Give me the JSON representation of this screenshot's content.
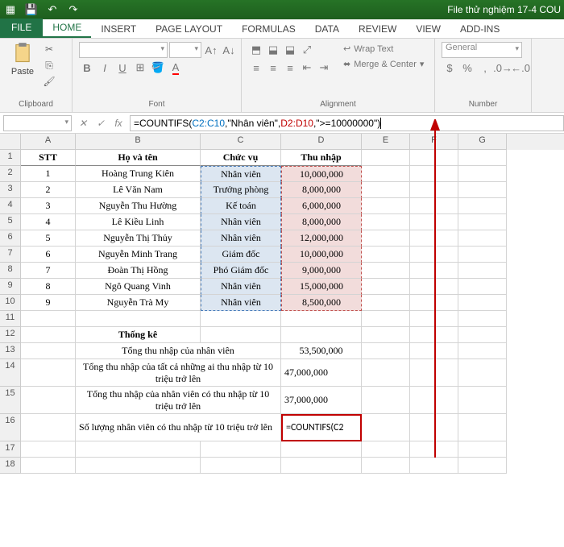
{
  "title": "File thử nghiệm 17-4 COU",
  "tabs": {
    "file": "FILE",
    "home": "HOME",
    "insert": "INSERT",
    "pageLayout": "PAGE LAYOUT",
    "formulas": "FORMULAS",
    "data": "DATA",
    "review": "REVIEW",
    "view": "VIEW",
    "addins": "ADD-INS"
  },
  "ribbon": {
    "clipboard": {
      "label": "Clipboard",
      "paste": "Paste"
    },
    "font": {
      "label": "Font"
    },
    "alignment": {
      "label": "Alignment",
      "wrap": "Wrap Text",
      "merge": "Merge & Center"
    },
    "number": {
      "label": "Number",
      "general": "General"
    }
  },
  "formula": {
    "prefix": "=COUNTIFS(",
    "rng1": "C2:C10",
    "arg1": ",\"Nhân viên\",",
    "rng2": "D2:D10",
    "arg2": ",\">=10000000\")"
  },
  "cols": [
    "A",
    "B",
    "C",
    "D",
    "E",
    "F",
    "G"
  ],
  "headers": {
    "stt": "STT",
    "name": "Họ và tên",
    "role": "Chức vụ",
    "income": "Thu nhập"
  },
  "data": [
    {
      "stt": "1",
      "name": "Hoàng Trung Kiên",
      "role": "Nhân viên",
      "income": "10,000,000"
    },
    {
      "stt": "2",
      "name": "Lê Văn Nam",
      "role": "Trưởng phòng",
      "income": "8,000,000"
    },
    {
      "stt": "3",
      "name": "Nguyễn Thu Hường",
      "role": "Kế toán",
      "income": "6,000,000"
    },
    {
      "stt": "4",
      "name": "Lê Kiều Linh",
      "role": "Nhân viên",
      "income": "8,000,000"
    },
    {
      "stt": "5",
      "name": "Nguyễn Thị Thủy",
      "role": "Nhân viên",
      "income": "12,000,000"
    },
    {
      "stt": "6",
      "name": "Nguyễn Minh Trang",
      "role": "Giám đốc",
      "income": "10,000,000"
    },
    {
      "stt": "7",
      "name": "Đoàn Thị Hồng",
      "role": "Phó Giám đốc",
      "income": "9,000,000"
    },
    {
      "stt": "8",
      "name": "Ngô Quang Vinh",
      "role": "Nhân viên",
      "income": "15,000,000"
    },
    {
      "stt": "9",
      "name": "Nguyễn Trà My",
      "role": "Nhân viên",
      "income": "8,500,000"
    }
  ],
  "stats": {
    "title": "Thống kê",
    "r13_label": "Tổng thu nhập của nhân viên",
    "r13_val": "53,500,000",
    "r14_label": "Tổng thu nhập của tất cả những ai thu nhập từ 10 triệu trở lên",
    "r14_val": "47,000,000",
    "r15_label": "Tổng thu nhập của nhân viên có thu nhập từ 10 triệu trở lên",
    "r15_val": "37,000,000",
    "r16_label": "Số lượng nhân viên có thu nhập từ 10 triệu trở lên",
    "r16_val": "=COUNTIFS(C2"
  }
}
